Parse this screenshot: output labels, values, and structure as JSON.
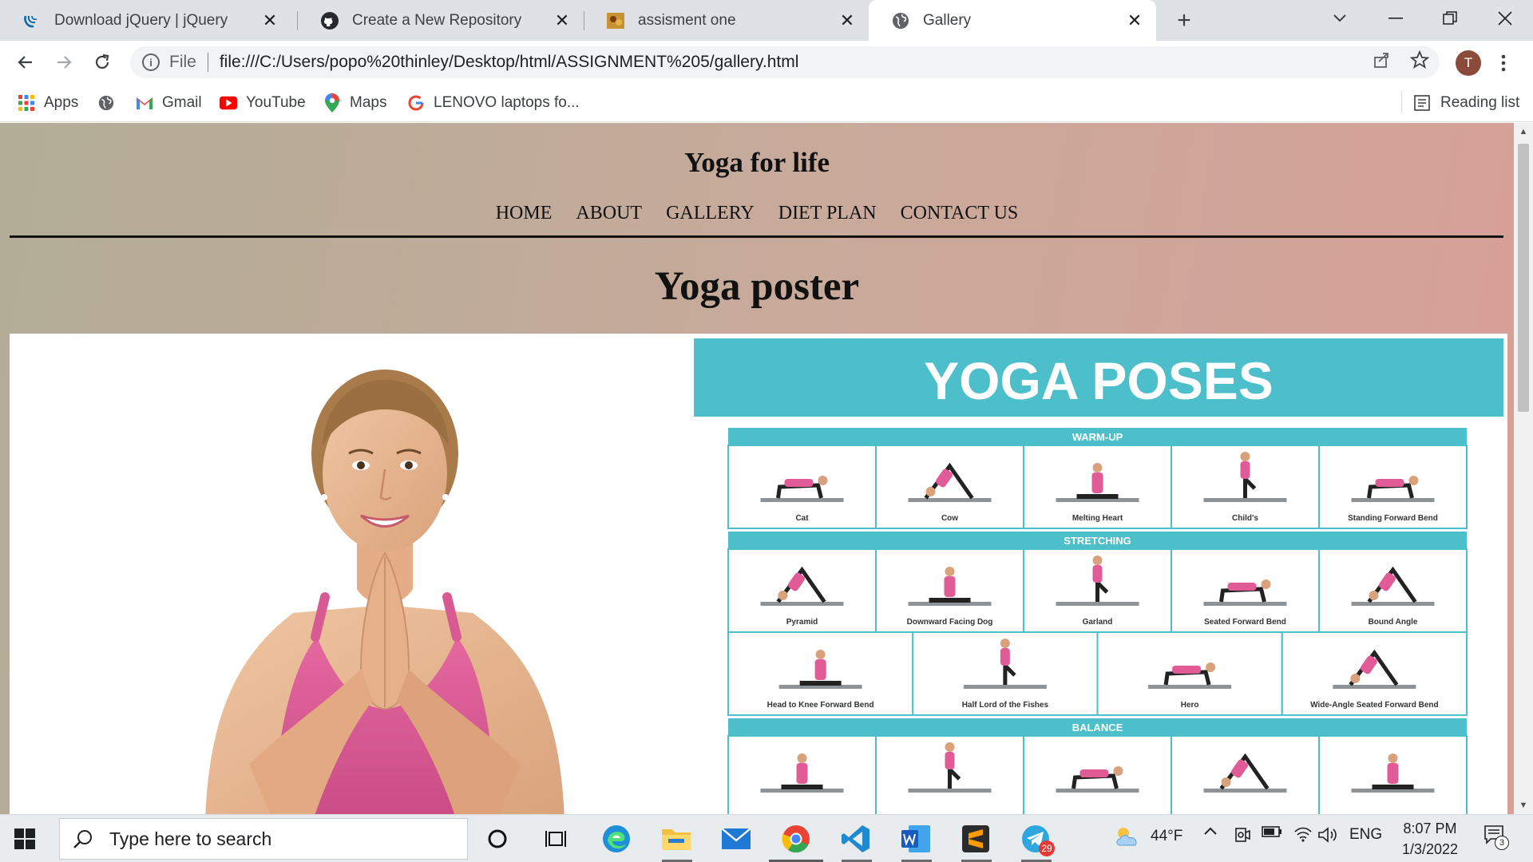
{
  "browser": {
    "tabs": [
      {
        "title": "Download jQuery | jQuery",
        "active": false
      },
      {
        "title": "Create a New Repository",
        "active": false
      },
      {
        "title": "assisment one",
        "active": false
      },
      {
        "title": "Gallery",
        "active": true
      }
    ],
    "address": {
      "scheme_label": "File",
      "url": "file:///C:/Users/popo%20thinley/Desktop/html/ASSIGNMENT%205/gallery.html"
    },
    "profile_initial": "T",
    "bookmarks": [
      {
        "label": "Apps"
      },
      {
        "label": ""
      },
      {
        "label": "Gmail"
      },
      {
        "label": "YouTube"
      },
      {
        "label": "Maps"
      },
      {
        "label": "LENOVO laptops fo..."
      }
    ],
    "reading_list_label": "Reading list"
  },
  "site": {
    "title": "Yoga for life",
    "nav": [
      "HOME",
      "ABOUT",
      "GALLERY",
      "DIET PLAN",
      "CONTACT US"
    ],
    "heading": "Yoga poster"
  },
  "poster": {
    "banner": "YOGA POSES",
    "sections": [
      {
        "title": "WARM-UP",
        "poses": [
          "Cat",
          "Cow",
          "Melting Heart",
          "Child's",
          "Standing Forward Bend"
        ]
      },
      {
        "title": "STRETCHING",
        "poses": [
          "Pyramid",
          "Downward Facing Dog",
          "Garland",
          "Seated Forward Bend",
          "Bound Angle",
          "Head to Knee Forward Bend",
          "Half Lord of the Fishes",
          "Hero",
          "Wide-Angle Seated Forward Bend"
        ]
      },
      {
        "title": "BALANCE",
        "poses": [
          "",
          "",
          "",
          "",
          ""
        ]
      }
    ],
    "accent_color": "#4cbfca",
    "pose_color": "#e15b97"
  },
  "taskbar": {
    "search_placeholder": "Type here to search",
    "weather": "44°F",
    "language": "ENG",
    "time": "8:07 PM",
    "date": "1/3/2022",
    "telegram_badge": "29",
    "notification_count": "3"
  }
}
